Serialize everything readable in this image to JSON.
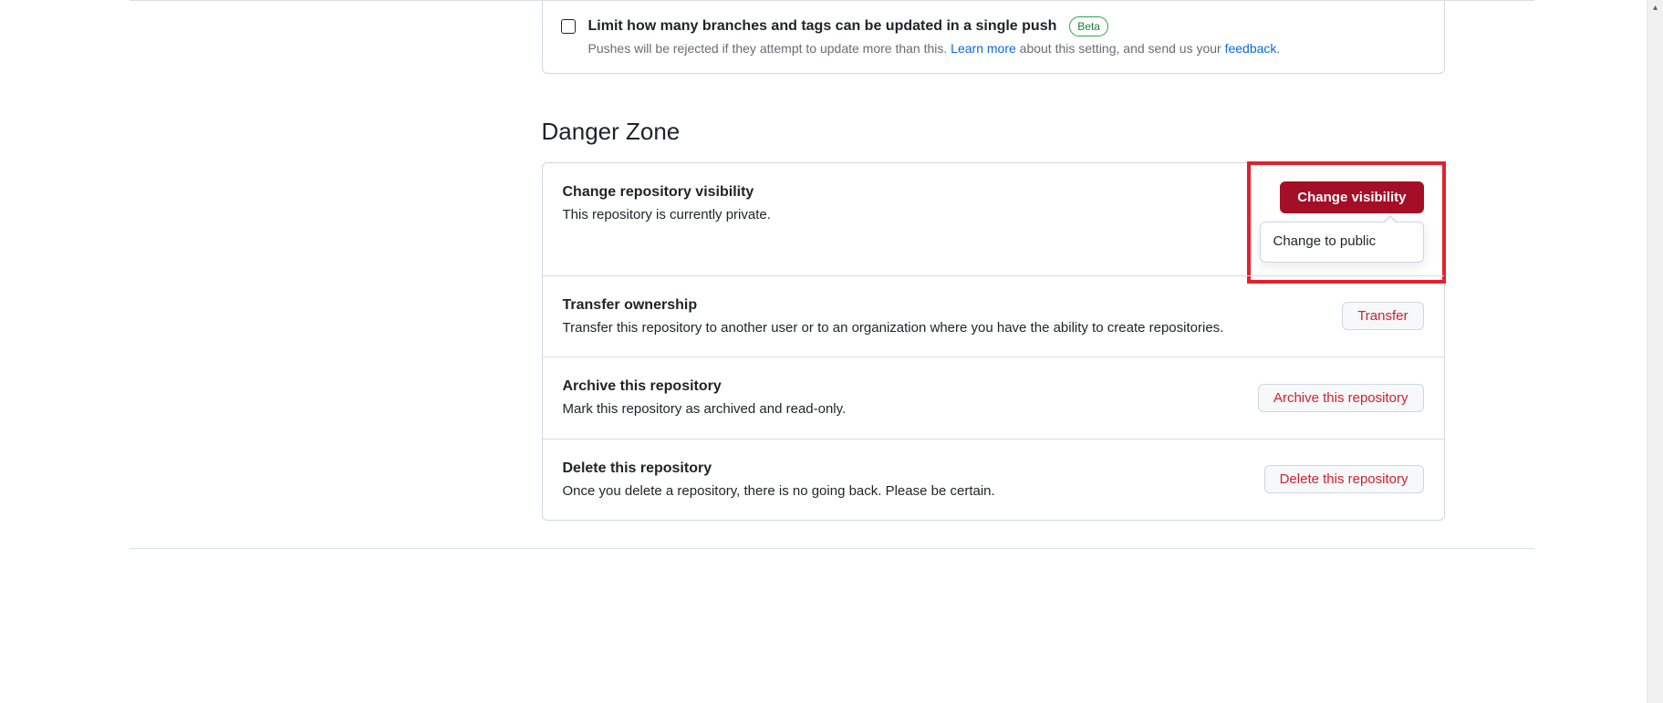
{
  "push_limit": {
    "title": "Limit how many branches and tags can be updated in a single push",
    "badge": "Beta",
    "desc_pre": "Pushes will be rejected if they attempt to update more than this. ",
    "learn_more": "Learn more",
    "desc_mid": " about this setting, and send us your ",
    "feedback": "feedback",
    "desc_post": "."
  },
  "danger_zone": {
    "heading": "Danger Zone",
    "items": [
      {
        "title": "Change repository visibility",
        "desc": "This repository is currently private.",
        "button": "Change visibility",
        "dropdown_option": "Change to public"
      },
      {
        "title": "Transfer ownership",
        "desc": "Transfer this repository to another user or to an organization where you have the ability to create repositories.",
        "button": "Transfer"
      },
      {
        "title": "Archive this repository",
        "desc": "Mark this repository as archived and read-only.",
        "button": "Archive this repository"
      },
      {
        "title": "Delete this repository",
        "desc": "Once you delete a repository, there is no going back. Please be certain.",
        "button": "Delete this repository"
      }
    ]
  }
}
